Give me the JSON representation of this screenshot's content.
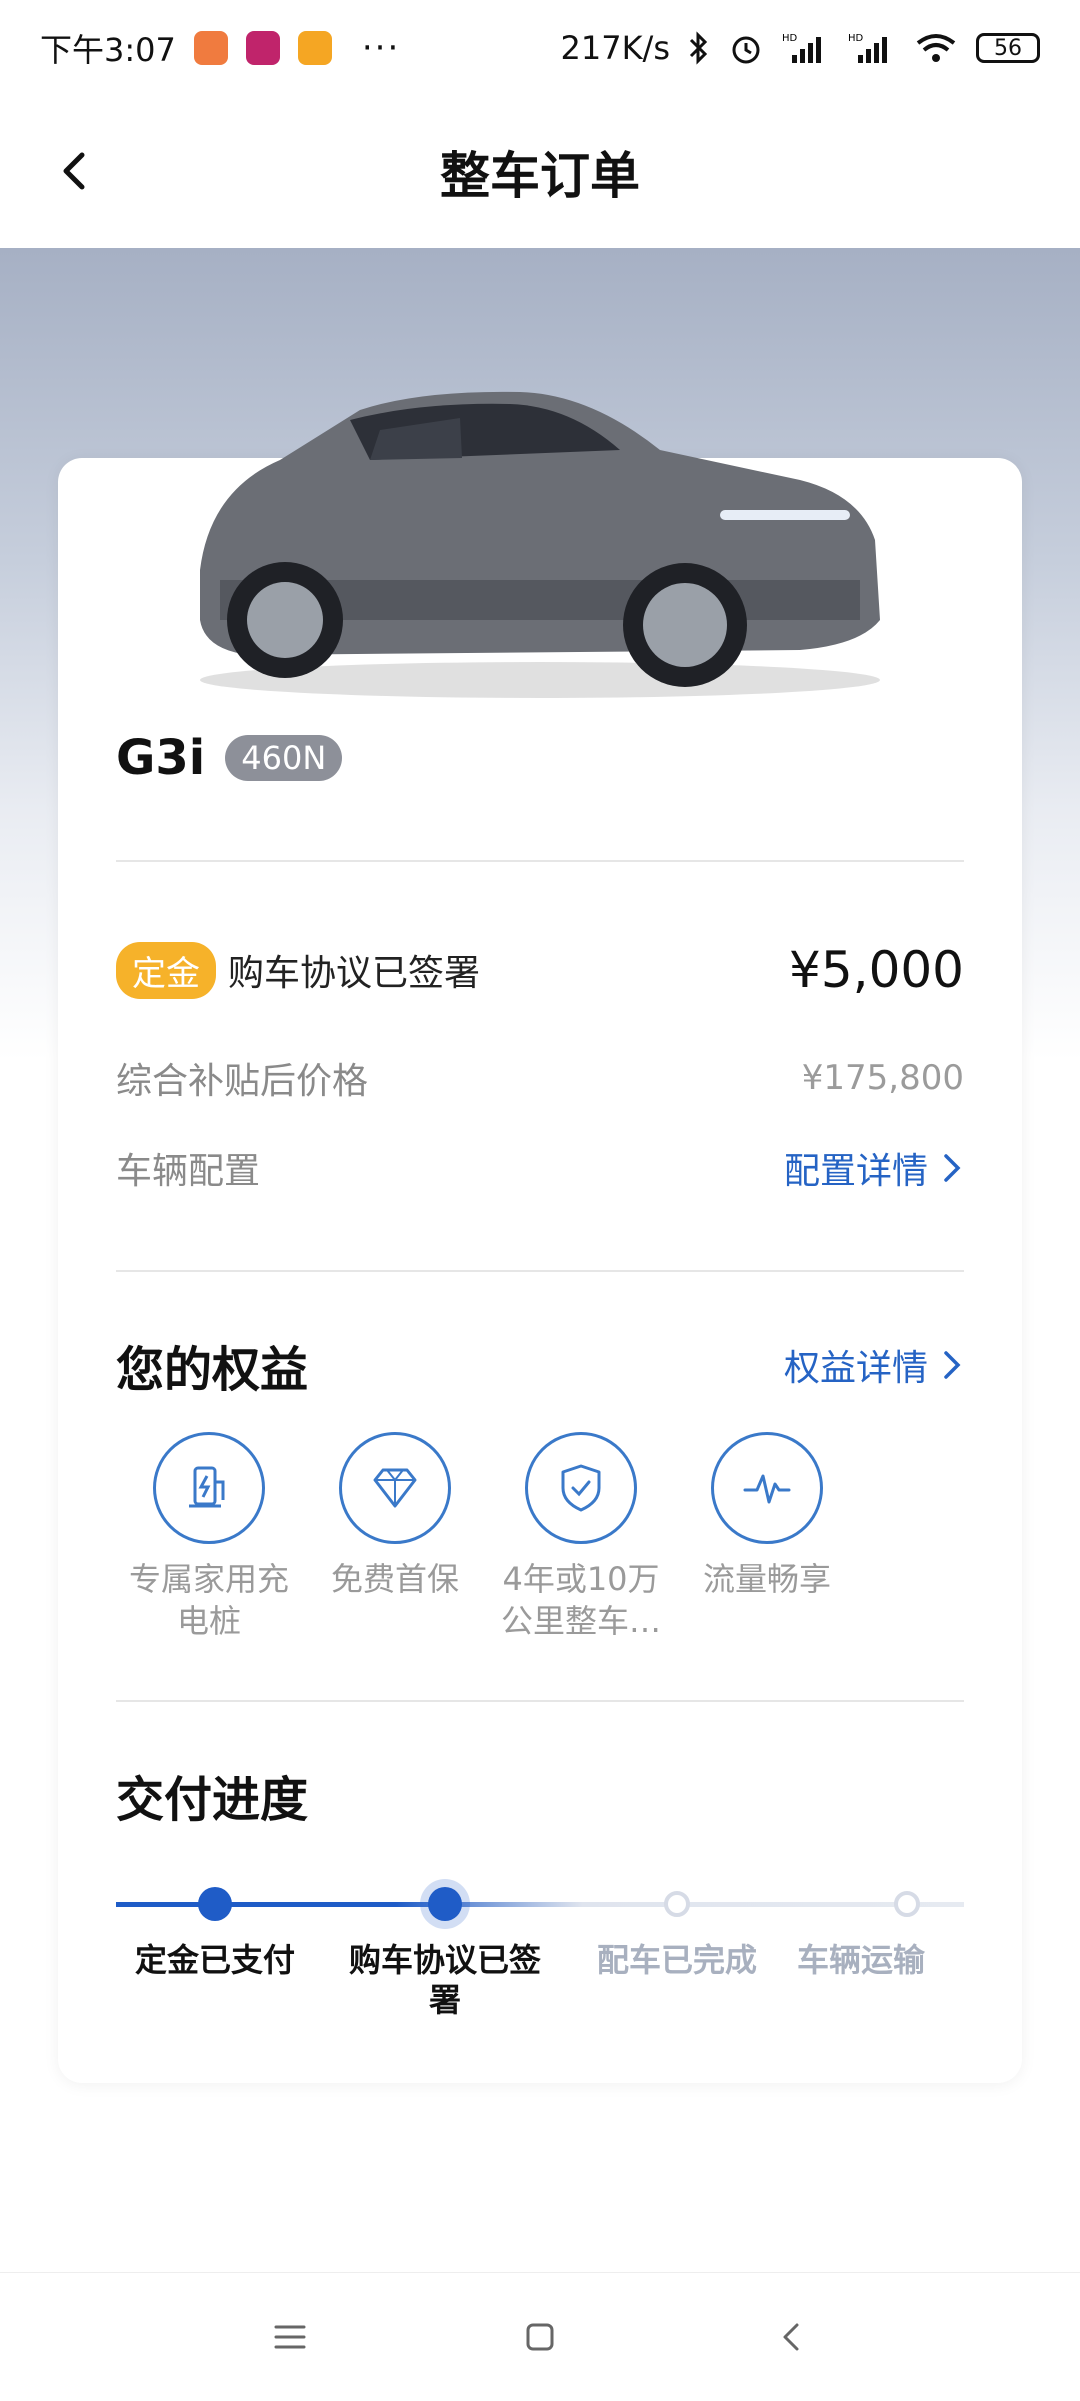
{
  "status_bar": {
    "time": "下午3:07",
    "network_speed": "217K/s",
    "battery": "56"
  },
  "header": {
    "title": "整车订单"
  },
  "car": {
    "model": "G3i",
    "variant": "460N"
  },
  "order": {
    "deposit_tag": "定金",
    "deposit_status": "购车协议已签署",
    "deposit_amount": "¥5,000",
    "price_label": "综合补贴后价格",
    "price_value": "¥175,800",
    "config_label": "车辆配置",
    "config_link": "配置详情"
  },
  "benefits": {
    "title": "您的权益",
    "link": "权益详情",
    "items": [
      {
        "label": "专属家用充\n电桩",
        "icon": "charging-pile-icon"
      },
      {
        "label": "免费首保",
        "icon": "diamond-icon"
      },
      {
        "label": "4年或10万\n公里整车…",
        "icon": "shield-check-icon"
      },
      {
        "label": "流量畅享",
        "icon": "pulse-icon"
      }
    ]
  },
  "delivery": {
    "title": "交付进度",
    "steps": [
      {
        "label": "定金已支付",
        "state": "done"
      },
      {
        "label": "购车协议已签署",
        "state": "current"
      },
      {
        "label": "配车已完成",
        "state": "todo"
      },
      {
        "label": "车辆运输",
        "state": "todo"
      }
    ]
  },
  "colors": {
    "accent_blue": "#2563c4",
    "deposit_yellow": "#f6b22a",
    "muted_gray": "#8a8a8a"
  }
}
